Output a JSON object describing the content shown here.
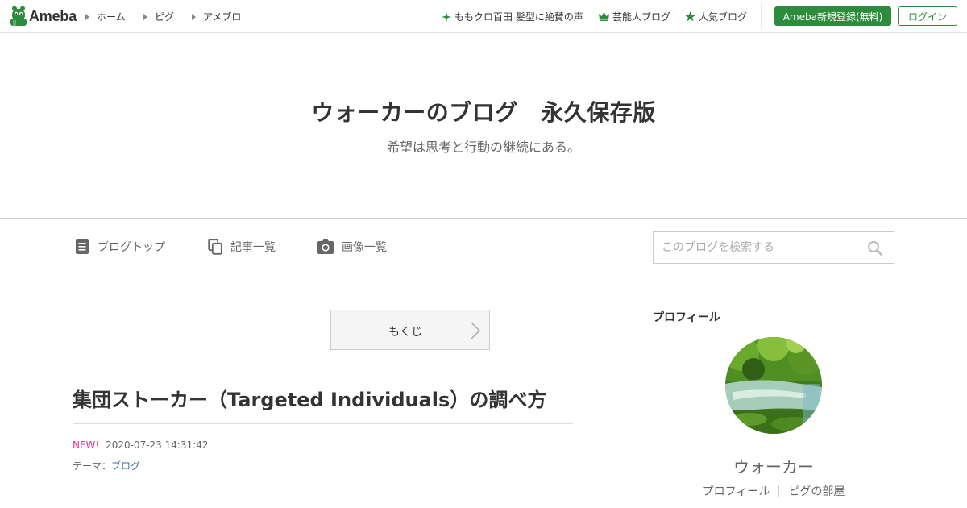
{
  "topbar": {
    "logo_text": "Ameba",
    "nav": [
      "ホーム",
      "ピグ",
      "アメブロ"
    ],
    "promos": [
      {
        "label": "ももクロ百田 髪型に絶賛の声",
        "icon": "sparkle-icon"
      },
      {
        "label": "芸能人ブログ",
        "icon": "crown-icon"
      },
      {
        "label": "人気ブログ",
        "icon": "star-icon"
      }
    ],
    "register_label": "Ameba新規登録(無料)",
    "login_label": "ログイン",
    "accent_color": "#2d8c3c"
  },
  "header": {
    "title": "ウォーカーのブログ　永久保存版",
    "subtitle": "希望は思考と行動の継続にある。"
  },
  "subnav": {
    "items": [
      {
        "label": "ブログトップ",
        "icon": "document-icon"
      },
      {
        "label": "記事一覧",
        "icon": "copy-icon"
      },
      {
        "label": "画像一覧",
        "icon": "camera-icon"
      }
    ],
    "search_placeholder": "このブログを検索する"
  },
  "main": {
    "toc_label": "もくじ",
    "article_title": "集団ストーカー（Targeted Individuals）の調べ方",
    "new_badge": "NEW!",
    "timestamp": "2020-07-23 14:31:42",
    "theme_prefix": "テーマ：",
    "theme_link": "ブログ",
    "new_color": "#e0338f",
    "link_color": "#3a6ea5"
  },
  "sidebar": {
    "heading": "プロフィール",
    "name": "ウォーカー",
    "links": [
      "プロフィール",
      "ピグの部屋"
    ]
  }
}
